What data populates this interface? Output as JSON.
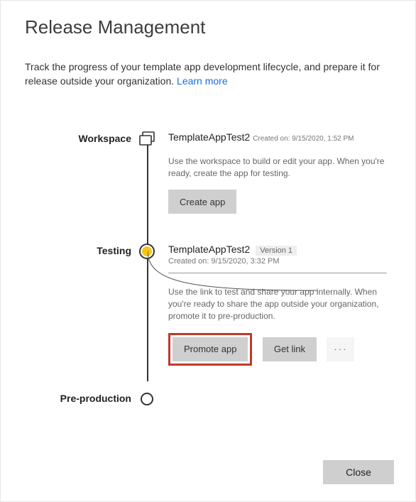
{
  "header": {
    "title": "Release Management"
  },
  "intro": {
    "text": "Track the progress of your template app development lifecycle, and prepare it for release outside your organization. ",
    "link_label": "Learn more"
  },
  "stages": {
    "workspace": {
      "label": "Workspace",
      "item_name": "TemplateAppTest2",
      "created_on": "Created on: 9/15/2020, 1:52 PM",
      "description": "Use the workspace to build or edit your app. When you're ready, create the app for testing.",
      "create_app_label": "Create app"
    },
    "testing": {
      "label": "Testing",
      "item_name": "TemplateAppTest2",
      "version_badge": "Version 1",
      "created_on": "Created on: 9/15/2020, 3:32 PM",
      "description": "Use the link to test and share your app internally. When you're ready to share the app outside your organization, promote it to pre-production.",
      "promote_label": "Promote app",
      "get_link_label": "Get link",
      "more_label": "···"
    },
    "preproduction": {
      "label": "Pre-production"
    }
  },
  "footer": {
    "close_label": "Close"
  }
}
